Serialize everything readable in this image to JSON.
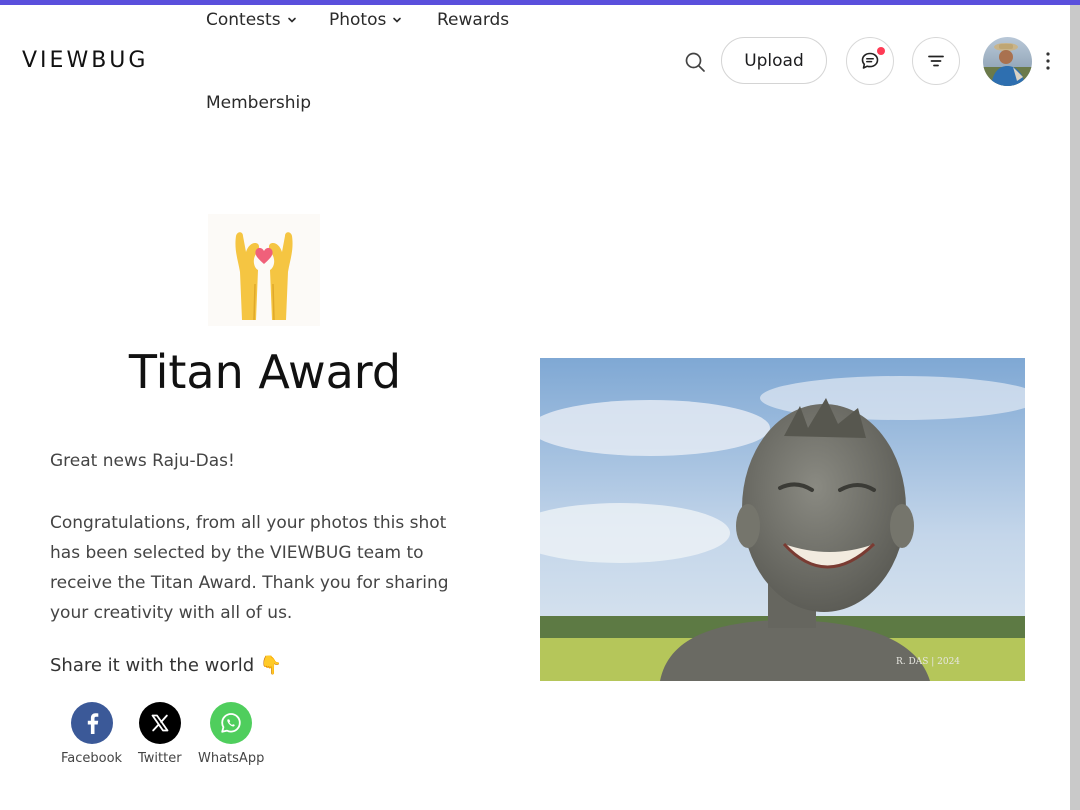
{
  "header": {
    "brand": "VIEWBUG",
    "nav": [
      {
        "label": "Contests",
        "has_dropdown": true
      },
      {
        "label": "Photos",
        "has_dropdown": true
      },
      {
        "label": "Rewards",
        "has_dropdown": false
      },
      {
        "label": "Membership",
        "has_dropdown": false
      }
    ],
    "search_icon": "search-icon",
    "upload_label": "Upload",
    "messages_icon": "chat-bubble-icon",
    "messages_has_notification": true,
    "filter_icon": "filter-icon",
    "more_icon": "kebab-vertical-icon"
  },
  "award": {
    "icon": "heart-hands-icon",
    "title": "Titan Award",
    "greeting": "Great news Raju-Das!",
    "message": "Congratulations, from all your photos this shot has been selected by the VIEWBUG team to receive the Titan Award. Thank you for sharing your creativity with all of us.",
    "share_title": "Share it with the world 👇"
  },
  "share": [
    {
      "label": "Facebook",
      "icon": "facebook-icon",
      "color": "#3b5998"
    },
    {
      "label": "Twitter",
      "icon": "x-twitter-icon",
      "color": "#000000"
    },
    {
      "label": "WhatsApp",
      "icon": "whatsapp-icon",
      "color": "#4fce5d"
    }
  ],
  "photo": {
    "watermark": "R. DAS | 2024"
  },
  "colors": {
    "accent_bar": "#5a4fdc",
    "notification": "#ff3b55"
  }
}
